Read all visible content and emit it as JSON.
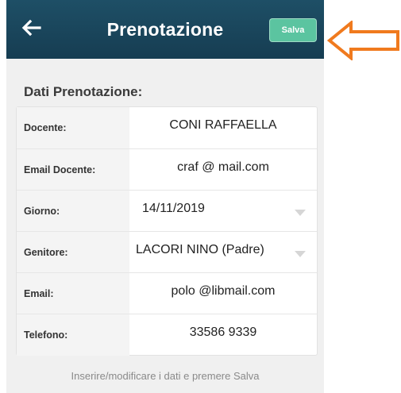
{
  "appbar": {
    "back_icon": "arrow-left-icon",
    "title": "Prenotazione",
    "save_label": "Salva"
  },
  "annotation": {
    "icon": "orange-arrow-left-icon",
    "color": "#f07a1e"
  },
  "section": {
    "title": "Dati Prenotazione:"
  },
  "form": {
    "rows": [
      {
        "label": "Docente:",
        "value": "CONI  RAFFAELLA"
      },
      {
        "label": "Email Docente:",
        "value": "craf @ mail.com"
      },
      {
        "label": "Giorno:",
        "value": "14/11/2019"
      },
      {
        "label": "Genitore:",
        "value": "LACORI NINO (Padre)"
      },
      {
        "label": "Email:",
        "value": "polo @libmail.com"
      },
      {
        "label": "Telefono:",
        "value": "33586 9339"
      }
    ]
  },
  "hint": "Inserire/modificare i dati e premere Salva",
  "colors": {
    "appbar": "#1e4f66",
    "save": "#5bc4a0",
    "arrow": "#f07a1e"
  }
}
